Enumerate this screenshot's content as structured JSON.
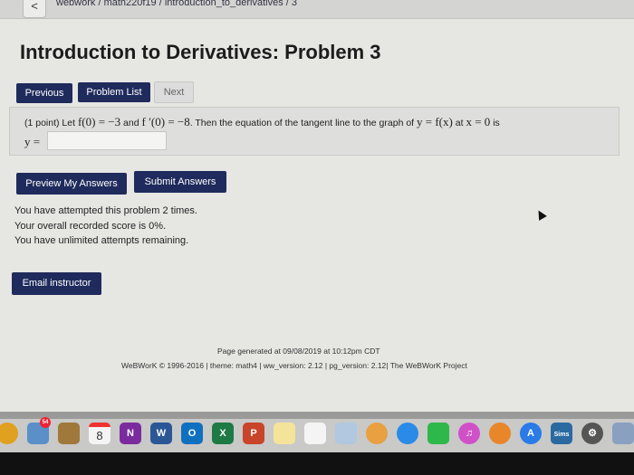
{
  "browser": {
    "back_label": "<",
    "breadcrumb": "webwork / math220f19 / introduction_to_derivatives / 3"
  },
  "page": {
    "title": "Introduction to Derivatives: Problem 3"
  },
  "nav": {
    "previous": "Previous",
    "problem_list": "Problem List",
    "next": "Next"
  },
  "problem": {
    "points": "(1 point) Let",
    "f0": "f(0) = −3",
    "and": "and",
    "fp0": "f ′(0) = −8",
    "middle": ". Then the equation of the tangent line to the graph of",
    "yfx": "y = f(x)",
    "at": "at",
    "x0": "x = 0",
    "is": "is",
    "answer_label": "y =",
    "answer_value": ""
  },
  "actions": {
    "preview": "Preview My Answers",
    "submit": "Submit Answers"
  },
  "status": {
    "attempts": "You have attempted this problem 2 times.",
    "score": "Your overall recorded score is 0%.",
    "remaining": "You have unlimited attempts remaining."
  },
  "email": {
    "label": "Email instructor"
  },
  "footer": {
    "generated": "Page generated at 09/08/2019 at 10:12pm CDT",
    "copyright": "WeBWorK © 1996-2016 | theme: math4 | ww_version: 2.12 | pg_version: 2.12| The WeBWorK Project"
  },
  "dock": {
    "mail_badge": "54",
    "calendar_day": "8",
    "apps": [
      {
        "name": "chrome-icon",
        "color": "#e0a020",
        "label": ""
      },
      {
        "name": "mail-icon",
        "color": "#5a8fc8",
        "label": ""
      },
      {
        "name": "contacts-icon",
        "color": "#a0783c",
        "label": ""
      },
      {
        "name": "calendar-icon",
        "color": "#f4f4f4",
        "label": ""
      },
      {
        "name": "onenote-icon",
        "color": "#7a2c9e",
        "label": "N"
      },
      {
        "name": "word-icon",
        "color": "#2b5797",
        "label": "W"
      },
      {
        "name": "outlook-icon",
        "color": "#1070c0",
        "label": "O"
      },
      {
        "name": "excel-icon",
        "color": "#1d7a44",
        "label": "X"
      },
      {
        "name": "powerpoint-icon",
        "color": "#c8452a",
        "label": "P"
      },
      {
        "name": "notes-icon",
        "color": "#f4e49a",
        "label": ""
      },
      {
        "name": "reminders-icon",
        "color": "#f4f4f4",
        "label": ""
      },
      {
        "name": "preview-icon",
        "color": "#b0c8e0",
        "label": ""
      },
      {
        "name": "photos-icon",
        "color": "#e8a040",
        "label": ""
      },
      {
        "name": "messages-icon",
        "color": "#2a8ae8",
        "label": ""
      },
      {
        "name": "facetime-icon",
        "color": "#2fb84a",
        "label": ""
      },
      {
        "name": "itunes-icon",
        "color": "#d050c8",
        "label": "♫"
      },
      {
        "name": "ibooks-icon",
        "color": "#e8862a",
        "label": ""
      },
      {
        "name": "app-store-icon",
        "color": "#2a7ae8",
        "label": "A"
      },
      {
        "name": "sims-icon",
        "color": "#2a6aa0",
        "label": "Sims"
      },
      {
        "name": "system-preferences-icon",
        "color": "#555",
        "label": "⚙"
      },
      {
        "name": "image-capture-icon",
        "color": "#8aa0c0",
        "label": ""
      }
    ]
  }
}
